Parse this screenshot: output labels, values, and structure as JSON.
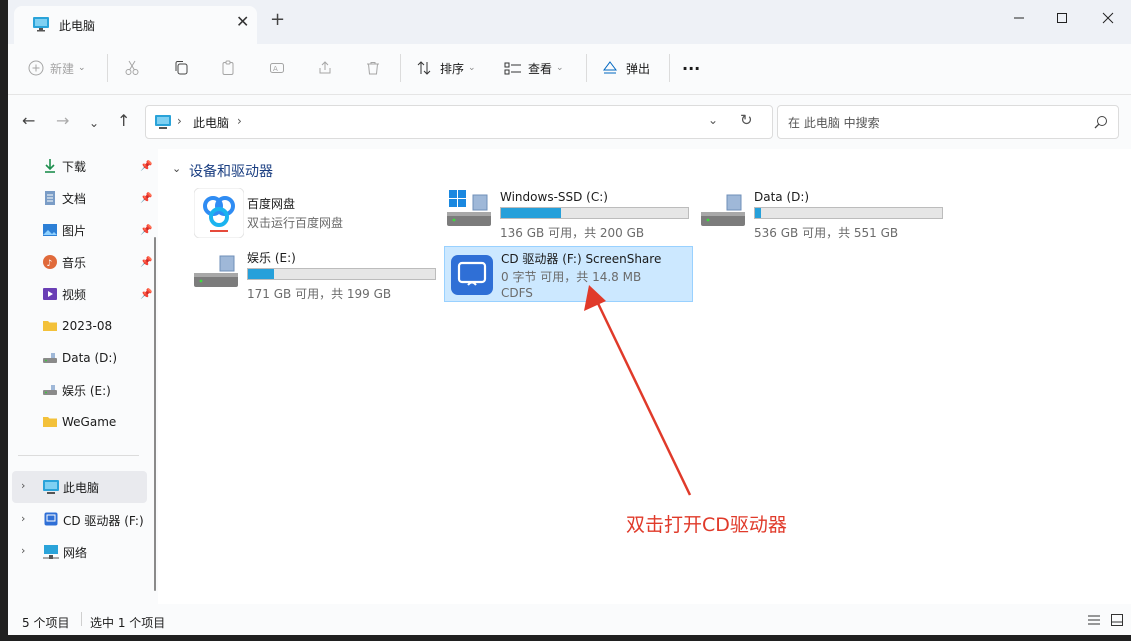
{
  "window": {
    "tab_title": "此电脑",
    "tab_close": "✕",
    "new_tab": "+",
    "minimize": "—",
    "maximize": "☐",
    "close": "✕"
  },
  "toolbar": {
    "new_label": "新建",
    "sort_label": "排序",
    "view_label": "查看",
    "eject_label": "弹出",
    "more_label": "···"
  },
  "address": {
    "path": "此电脑",
    "search_placeholder": "在 此电脑 中搜索"
  },
  "sidebar": {
    "quick_access": [
      {
        "label": "下载",
        "icon": "download-icon",
        "pinned": true
      },
      {
        "label": "文档",
        "icon": "document-icon",
        "pinned": true
      },
      {
        "label": "图片",
        "icon": "picture-icon",
        "pinned": true
      },
      {
        "label": "音乐",
        "icon": "music-icon",
        "pinned": true
      },
      {
        "label": "视频",
        "icon": "video-icon",
        "pinned": true
      },
      {
        "label": "2023-08",
        "icon": "folder-icon",
        "pinned": false
      },
      {
        "label": "Data (D:)",
        "icon": "drive-icon",
        "pinned": false
      },
      {
        "label": "娱乐 (E:)",
        "icon": "drive-icon",
        "pinned": false
      },
      {
        "label": "WeGame",
        "icon": "folder-icon",
        "pinned": false
      }
    ],
    "tree": [
      {
        "label": "此电脑",
        "icon": "computer-icon",
        "selected": true
      },
      {
        "label": "CD 驱动器 (F:) S",
        "icon": "cd-drive-icon",
        "selected": false
      },
      {
        "label": "网络",
        "icon": "network-icon",
        "selected": false
      }
    ]
  },
  "content": {
    "section_title": "设备和驱动器",
    "drives": [
      {
        "name": "百度网盘",
        "sub": "双击运行百度网盘",
        "icon": "baidu-netdisk-icon"
      },
      {
        "name": "Windows-SSD (C:)",
        "sub": "136 GB 可用，共 200 GB",
        "used_fraction": 0.32,
        "icon": "windows-drive-icon"
      },
      {
        "name": "Data (D:)",
        "sub": "536 GB 可用，共 551 GB",
        "used_fraction": 0.03,
        "icon": "drive-icon"
      },
      {
        "name": "娱乐 (E:)",
        "sub": "171 GB 可用，共 199 GB",
        "used_fraction": 0.14,
        "icon": "drive-icon"
      },
      {
        "name": "CD 驱动器 (F:) ScreenShare",
        "sub": "0 字节 可用，共 14.8 MB",
        "fs": "CDFS",
        "icon": "screenshare-icon",
        "selected": true
      }
    ]
  },
  "annotation": {
    "text": "双击打开CD驱动器",
    "color": "#e03a2a"
  },
  "status": {
    "count": "5 个项目",
    "selected": "选中 1 个项目"
  },
  "colors": {
    "accent": "#0067c0",
    "selection": "#cce8ff",
    "usage_bar": "#26a0da"
  }
}
